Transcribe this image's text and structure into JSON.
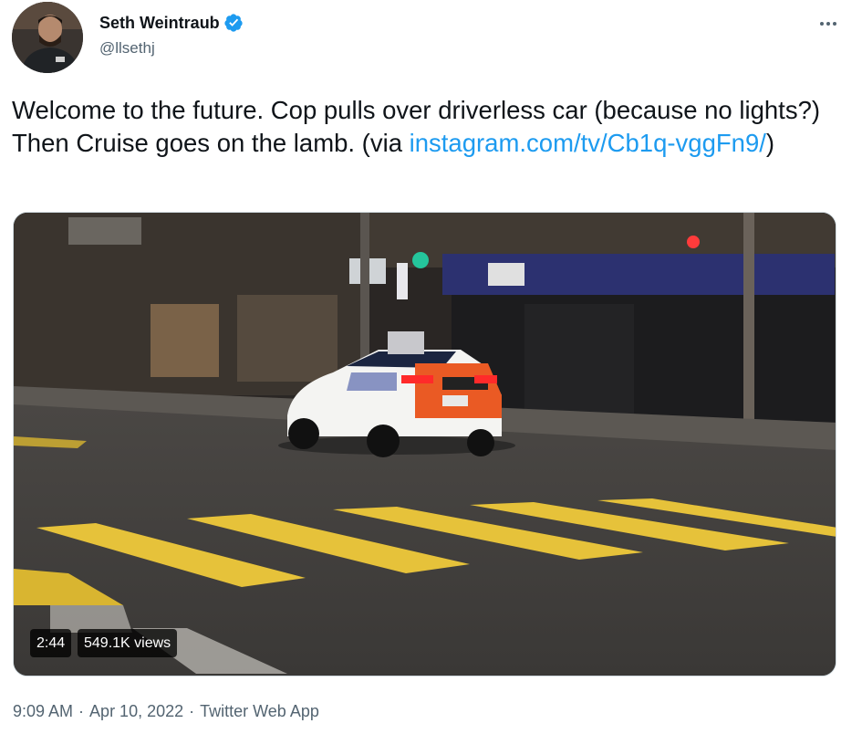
{
  "author": {
    "name": "Seth Weintraub",
    "handle": "@llsethj",
    "verified": true
  },
  "tweet": {
    "text_before": "Welcome to the future. Cop pulls over driverless car (because no lights?) Then Cruise goes on the lamb. (via ",
    "link_text": "instagram.com/tv/Cb1q-vggFn9/",
    "text_after": ")"
  },
  "media": {
    "duration": "2:44",
    "views": "549.1K views"
  },
  "meta": {
    "time": "9:09 AM",
    "separator": "·",
    "date": "Apr 10, 2022",
    "app": "Twitter Web App"
  },
  "icons": {
    "verified": "verified-badge-icon",
    "more": "more-options-icon"
  },
  "colors": {
    "link": "#1d9bf0",
    "secondary_text": "#536471",
    "primary_text": "#0f1419"
  }
}
